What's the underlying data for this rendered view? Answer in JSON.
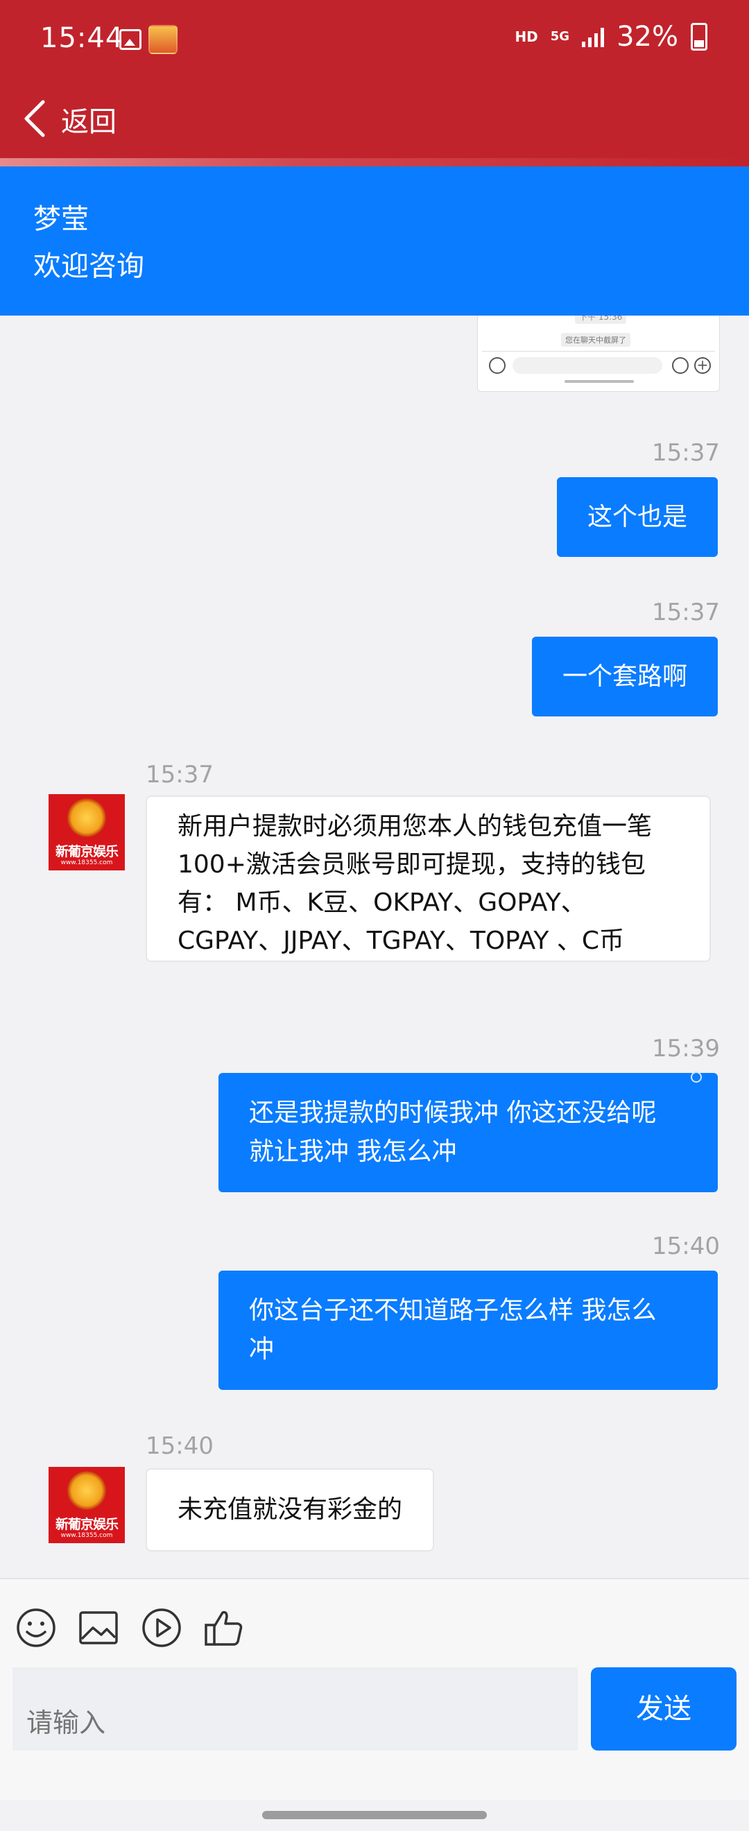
{
  "status_bar": {
    "time": "15:44",
    "network_hd": "HD",
    "network_5g": "5G",
    "battery": "32%",
    "icons": [
      "gallery-icon",
      "app-notification-icon",
      "signal-icon",
      "battery-icon"
    ]
  },
  "nav": {
    "back_label": "返回"
  },
  "agent": {
    "name": "梦莹",
    "subtitle": "欢迎咨询"
  },
  "messages": [
    {
      "side": "out",
      "time": "15:37",
      "text": "这个也是"
    },
    {
      "side": "out",
      "time": "15:37",
      "text": "一个套路啊"
    },
    {
      "side": "in",
      "time": "15:37",
      "lines": [
        "新用户提款时必须用您本人的钱包充值一笔",
        "100+激活会员账号即可提现，支持的钱包",
        "有： M币、K豆、OKPAY、GOPAY、",
        "CGPAY、JJPAY、TGPAY、TOPAY 、C币"
      ]
    },
    {
      "side": "out",
      "time": "15:39",
      "lines": [
        "还是我提款的时候我冲 你这还没给呢",
        "就让我冲 我怎么冲"
      ]
    },
    {
      "side": "out",
      "time": "15:40",
      "lines": [
        "你这台子还不知道路子怎么样 我怎么",
        "冲"
      ]
    },
    {
      "side": "in",
      "time": "15:40",
      "text": "未充值就没有彩金的"
    }
  ],
  "avatar": {
    "text": "新葡京娱乐",
    "url": "www.18355.com"
  },
  "composer": {
    "placeholder": "请输入",
    "send_label": "发送",
    "tools": [
      "emoji-icon",
      "image-icon",
      "video-icon",
      "thumbs-up-icon"
    ]
  },
  "colors": {
    "header_red": "#c1232c",
    "accent_blue": "#0a7cff",
    "chat_bg": "#f2f2f4"
  }
}
